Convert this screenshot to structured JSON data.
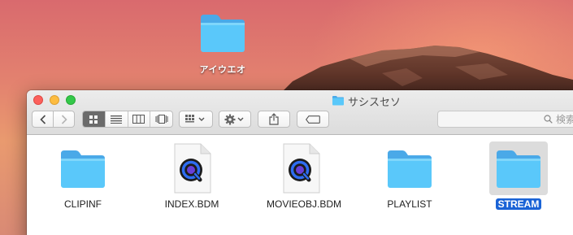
{
  "desktop": {
    "folder": {
      "label": "アイウエオ",
      "icon": "folder-icon"
    }
  },
  "window": {
    "title": "サシスセソ",
    "search_placeholder": "検索",
    "toolbar": {
      "back": "‹",
      "forward": "›",
      "views": [
        "icon-view",
        "list-view",
        "column-view",
        "cover-flow-view"
      ],
      "active_view": "icon-view",
      "arrange": "arrange-icon",
      "action": "gear-icon",
      "share": "share-icon",
      "tag": "tag-icon"
    },
    "files": [
      {
        "name": "CLIPINF",
        "kind": "folder",
        "selected": false
      },
      {
        "name": "INDEX.BDM",
        "kind": "quicktime-document",
        "selected": false
      },
      {
        "name": "MOVIEOBJ.BDM",
        "kind": "quicktime-document",
        "selected": false
      },
      {
        "name": "PLAYLIST",
        "kind": "folder",
        "selected": false
      },
      {
        "name": "STREAM",
        "kind": "folder",
        "selected": true
      }
    ]
  },
  "colors": {
    "folder": "#5ac8fa",
    "selection": "#1a63d6",
    "close": "#fc605c",
    "minimize": "#fdbc40",
    "zoom": "#34c84a"
  }
}
